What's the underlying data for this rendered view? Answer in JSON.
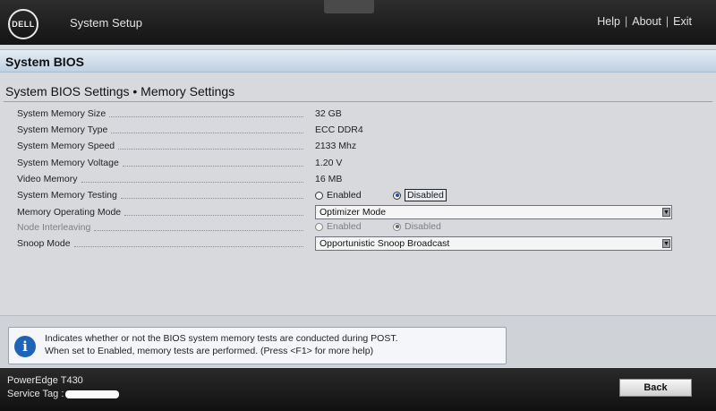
{
  "header": {
    "logo_text": "DELL",
    "app_title": "System Setup",
    "links": [
      "Help",
      "About",
      "Exit"
    ]
  },
  "section_title": "System BIOS",
  "page_subtitle": "System BIOS Settings • Memory Settings",
  "settings": {
    "memory_size": {
      "label": "System Memory Size",
      "value": "32 GB"
    },
    "memory_type": {
      "label": "System Memory Type",
      "value": "ECC DDR4"
    },
    "memory_speed": {
      "label": "System Memory Speed",
      "value": "2133 Mhz"
    },
    "memory_voltage": {
      "label": "System Memory Voltage",
      "value": "1.20 V"
    },
    "video_memory": {
      "label": "Video Memory",
      "value": "16 MB"
    },
    "memory_testing": {
      "label": "System Memory Testing",
      "options": [
        "Enabled",
        "Disabled"
      ],
      "selected": "Disabled"
    },
    "operating_mode": {
      "label": "Memory Operating Mode",
      "value": "Optimizer Mode"
    },
    "node_interleaving": {
      "label": "Node Interleaving",
      "options": [
        "Enabled",
        "Disabled"
      ],
      "selected": "Disabled",
      "disabled": true
    },
    "snoop_mode": {
      "label": "Snoop Mode",
      "value": "Opportunistic Snoop Broadcast"
    }
  },
  "help": {
    "line1": "Indicates whether or not the BIOS system memory tests are conducted during POST.",
    "line2": "When set to Enabled, memory tests are performed. (Press <F1> for more help)"
  },
  "footer": {
    "model": "PowerEdge T430",
    "service_tag_label": "Service Tag :",
    "back_label": "Back"
  },
  "colors": {
    "accent_blue": "#1f63b6",
    "header_band": "#bfd0e2",
    "topbar": "#1a1a1a"
  }
}
